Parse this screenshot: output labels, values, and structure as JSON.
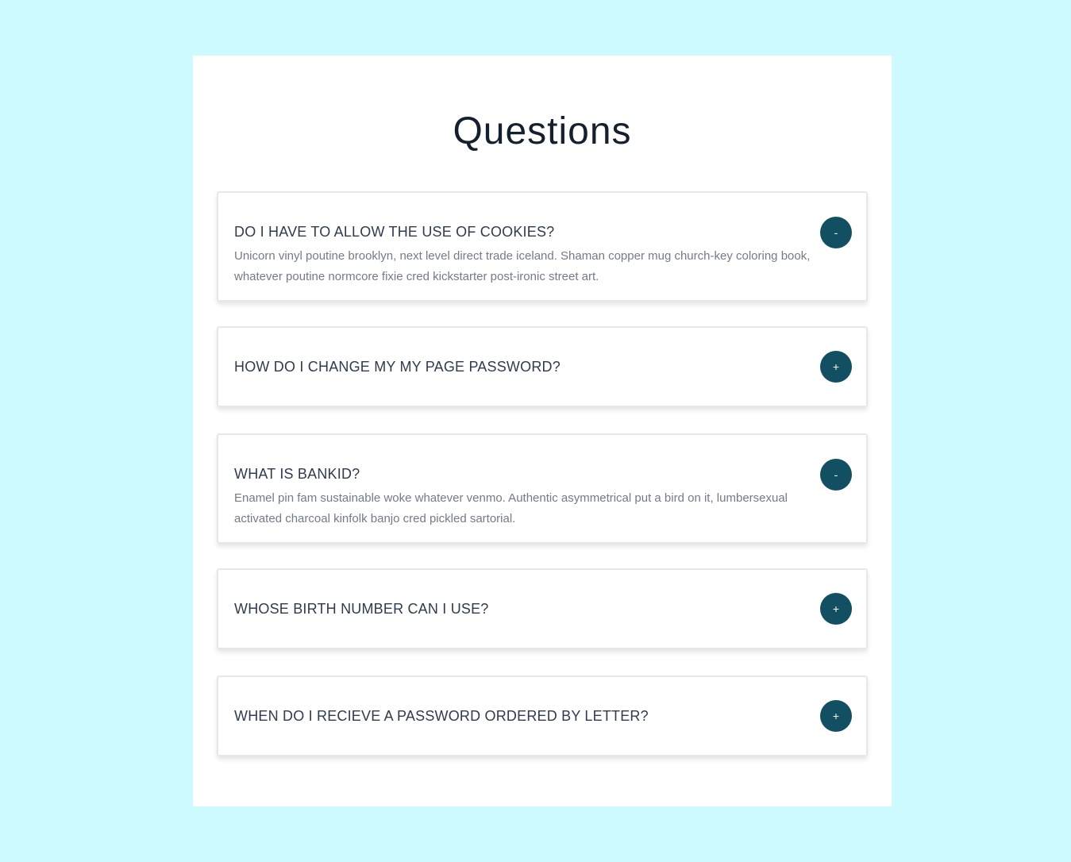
{
  "page": {
    "title": "Questions"
  },
  "faq": {
    "items": [
      {
        "question": "DO I HAVE TO ALLOW THE USE OF COOKIES?",
        "answer": "Unicorn vinyl poutine brooklyn, next level direct trade iceland. Shaman copper mug church-key coloring book, whatever poutine normcore fixie cred kickstarter post-ironic street art.",
        "toggle": "-",
        "expanded": true
      },
      {
        "question": "HOW DO I CHANGE MY MY PAGE PASSWORD?",
        "answer": "",
        "toggle": "+",
        "expanded": false
      },
      {
        "question": "WHAT IS BANKID?",
        "answer": "Enamel pin fam sustainable woke whatever venmo. Authentic asymmetrical put a bird on it, lumbersexual activated charcoal kinfolk banjo cred pickled sartorial.",
        "toggle": "-",
        "expanded": true
      },
      {
        "question": "WHOSE BIRTH NUMBER CAN I USE?",
        "answer": "",
        "toggle": "+",
        "expanded": false
      },
      {
        "question": "WHEN DO I RECIEVE A PASSWORD ORDERED BY LETTER?",
        "answer": "",
        "toggle": "+",
        "expanded": false
      }
    ]
  },
  "colors": {
    "background": "#cdfafe",
    "card": "#ffffff",
    "accent": "#134f62",
    "question_text": "#2f3b4f",
    "answer_text": "#747a8a"
  }
}
